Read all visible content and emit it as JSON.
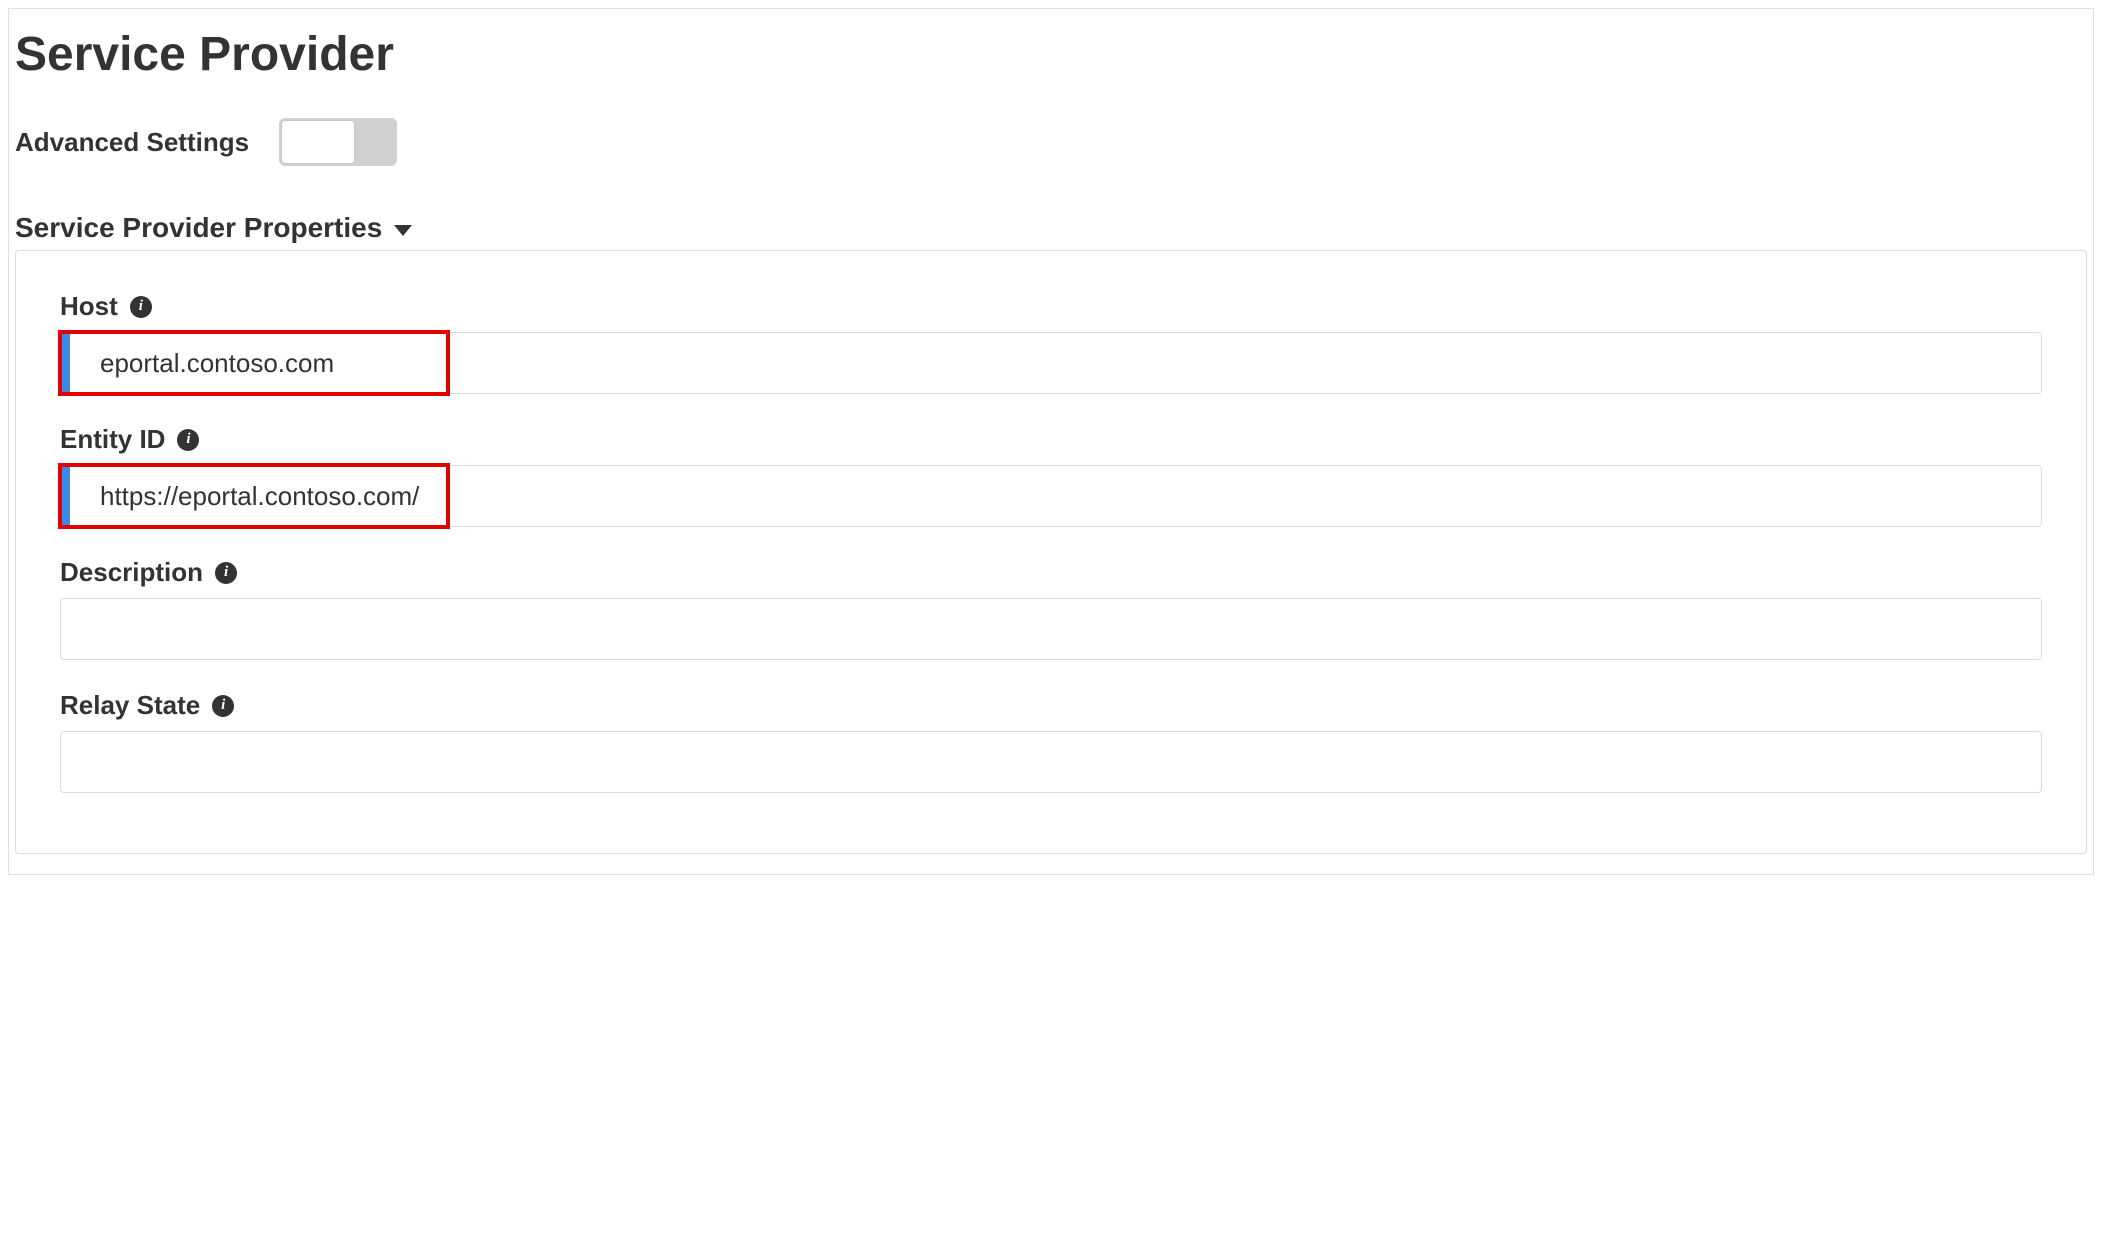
{
  "page": {
    "title": "Service Provider"
  },
  "advanced_settings": {
    "label": "Advanced Settings",
    "enabled": false
  },
  "section": {
    "title": "Service Provider Properties"
  },
  "fields": {
    "host": {
      "label": "Host",
      "value": "eportal.contoso.com",
      "highlighted": true
    },
    "entity_id": {
      "label": "Entity ID",
      "value": "https://eportal.contoso.com/",
      "highlighted": true
    },
    "description": {
      "label": "Description",
      "value": ""
    },
    "relay_state": {
      "label": "Relay State",
      "value": ""
    }
  }
}
